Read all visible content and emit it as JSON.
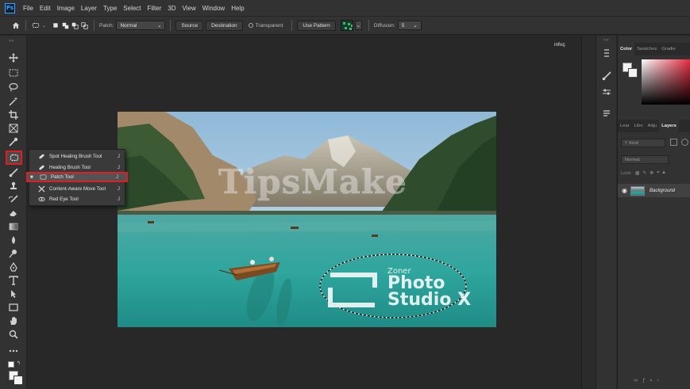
{
  "menubar": {
    "logo": "Ps",
    "items": [
      "File",
      "Edit",
      "Image",
      "Layer",
      "Type",
      "Select",
      "Filter",
      "3D",
      "View",
      "Window",
      "Help"
    ]
  },
  "options": {
    "patch_label": "Patch:",
    "patch_value": "Normal",
    "source_label": "Source",
    "destination_label": "Destination",
    "transparent_label": "Transparent",
    "use_pattern_label": "Use Pattern",
    "diffusion_label": "Diffusion:",
    "diffusion_value": "5"
  },
  "flyout": {
    "items": [
      {
        "label": "Spot Healing Brush Tool",
        "key": "J"
      },
      {
        "label": "Healing Brush Tool",
        "key": "J"
      },
      {
        "label": "Patch Tool",
        "key": "J"
      },
      {
        "label": "Content-Aware Move Tool",
        "key": "J"
      },
      {
        "label": "Red Eye Tool",
        "key": "J"
      }
    ]
  },
  "document": {
    "tab_label": "infoç",
    "watermark": "TipsMake",
    "logo_line1": "Zoner",
    "logo_line2": "Photo",
    "logo_line3": "Studio X"
  },
  "panels": {
    "color_tabs": [
      "Color",
      "Swatches",
      "Gradie"
    ],
    "layer_tabs": [
      "Lear",
      "Libn",
      "Adju",
      "Layers"
    ],
    "kind_placeholder": "Kind",
    "blend_mode": "Normal",
    "lock_label": "Lock:",
    "layer_name": "Background"
  },
  "colors": {
    "selection_highlight": "#e21c23",
    "panel_bg": "#323232",
    "canvas_bg": "#282828"
  }
}
